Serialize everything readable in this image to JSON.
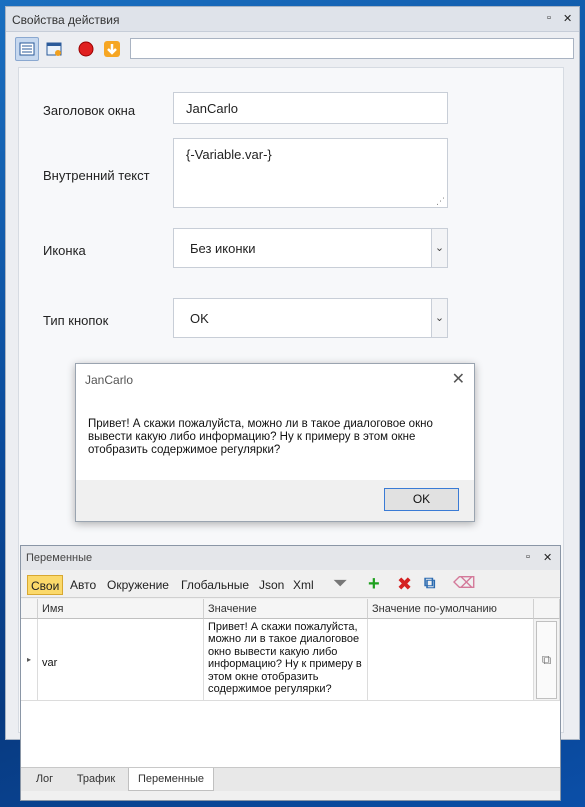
{
  "panel": {
    "title": "Свойства действия",
    "address_value": ""
  },
  "form": {
    "window_title_label": "Заголовок окна",
    "window_title_value": "JanCarlo",
    "inner_text_label": "Внутренний текст",
    "inner_text_value": "{-Variable.var-}",
    "icon_label": "Иконка",
    "icon_value": "Без иконки",
    "buttons_type_label": "Тип кнопок",
    "buttons_type_value": "OK"
  },
  "dialog": {
    "title": "JanCarlo",
    "message": "Привет! А скажи пожалуйста, можно ли в такое диалоговое окно вывести какую либо информацию? Ну к примеру в этом окне отобразить содержимое регулярки?",
    "ok_label": "OK"
  },
  "variables": {
    "title": "Переменные",
    "tabs": [
      "Свои",
      "Авто",
      "Окружение",
      "Глобальные",
      "Json",
      "Xml"
    ],
    "columns": [
      "Имя",
      "Значение",
      "Значение по-умолчанию"
    ],
    "rows": [
      {
        "name": "var",
        "value": "Привет! А скажи пожалуйста, можно ли в такое диалоговое окно вывести какую либо информацию? Ну к примеру в этом окне отобразить содержимое регулярки?",
        "default": ""
      }
    ],
    "bottom_tabs": [
      "Лог",
      "Трафик",
      "Переменные"
    ]
  },
  "colors": {
    "accent": "#3a7bd5",
    "selected_tab": "#fbd96a",
    "desktop": "#0a4a9a"
  }
}
